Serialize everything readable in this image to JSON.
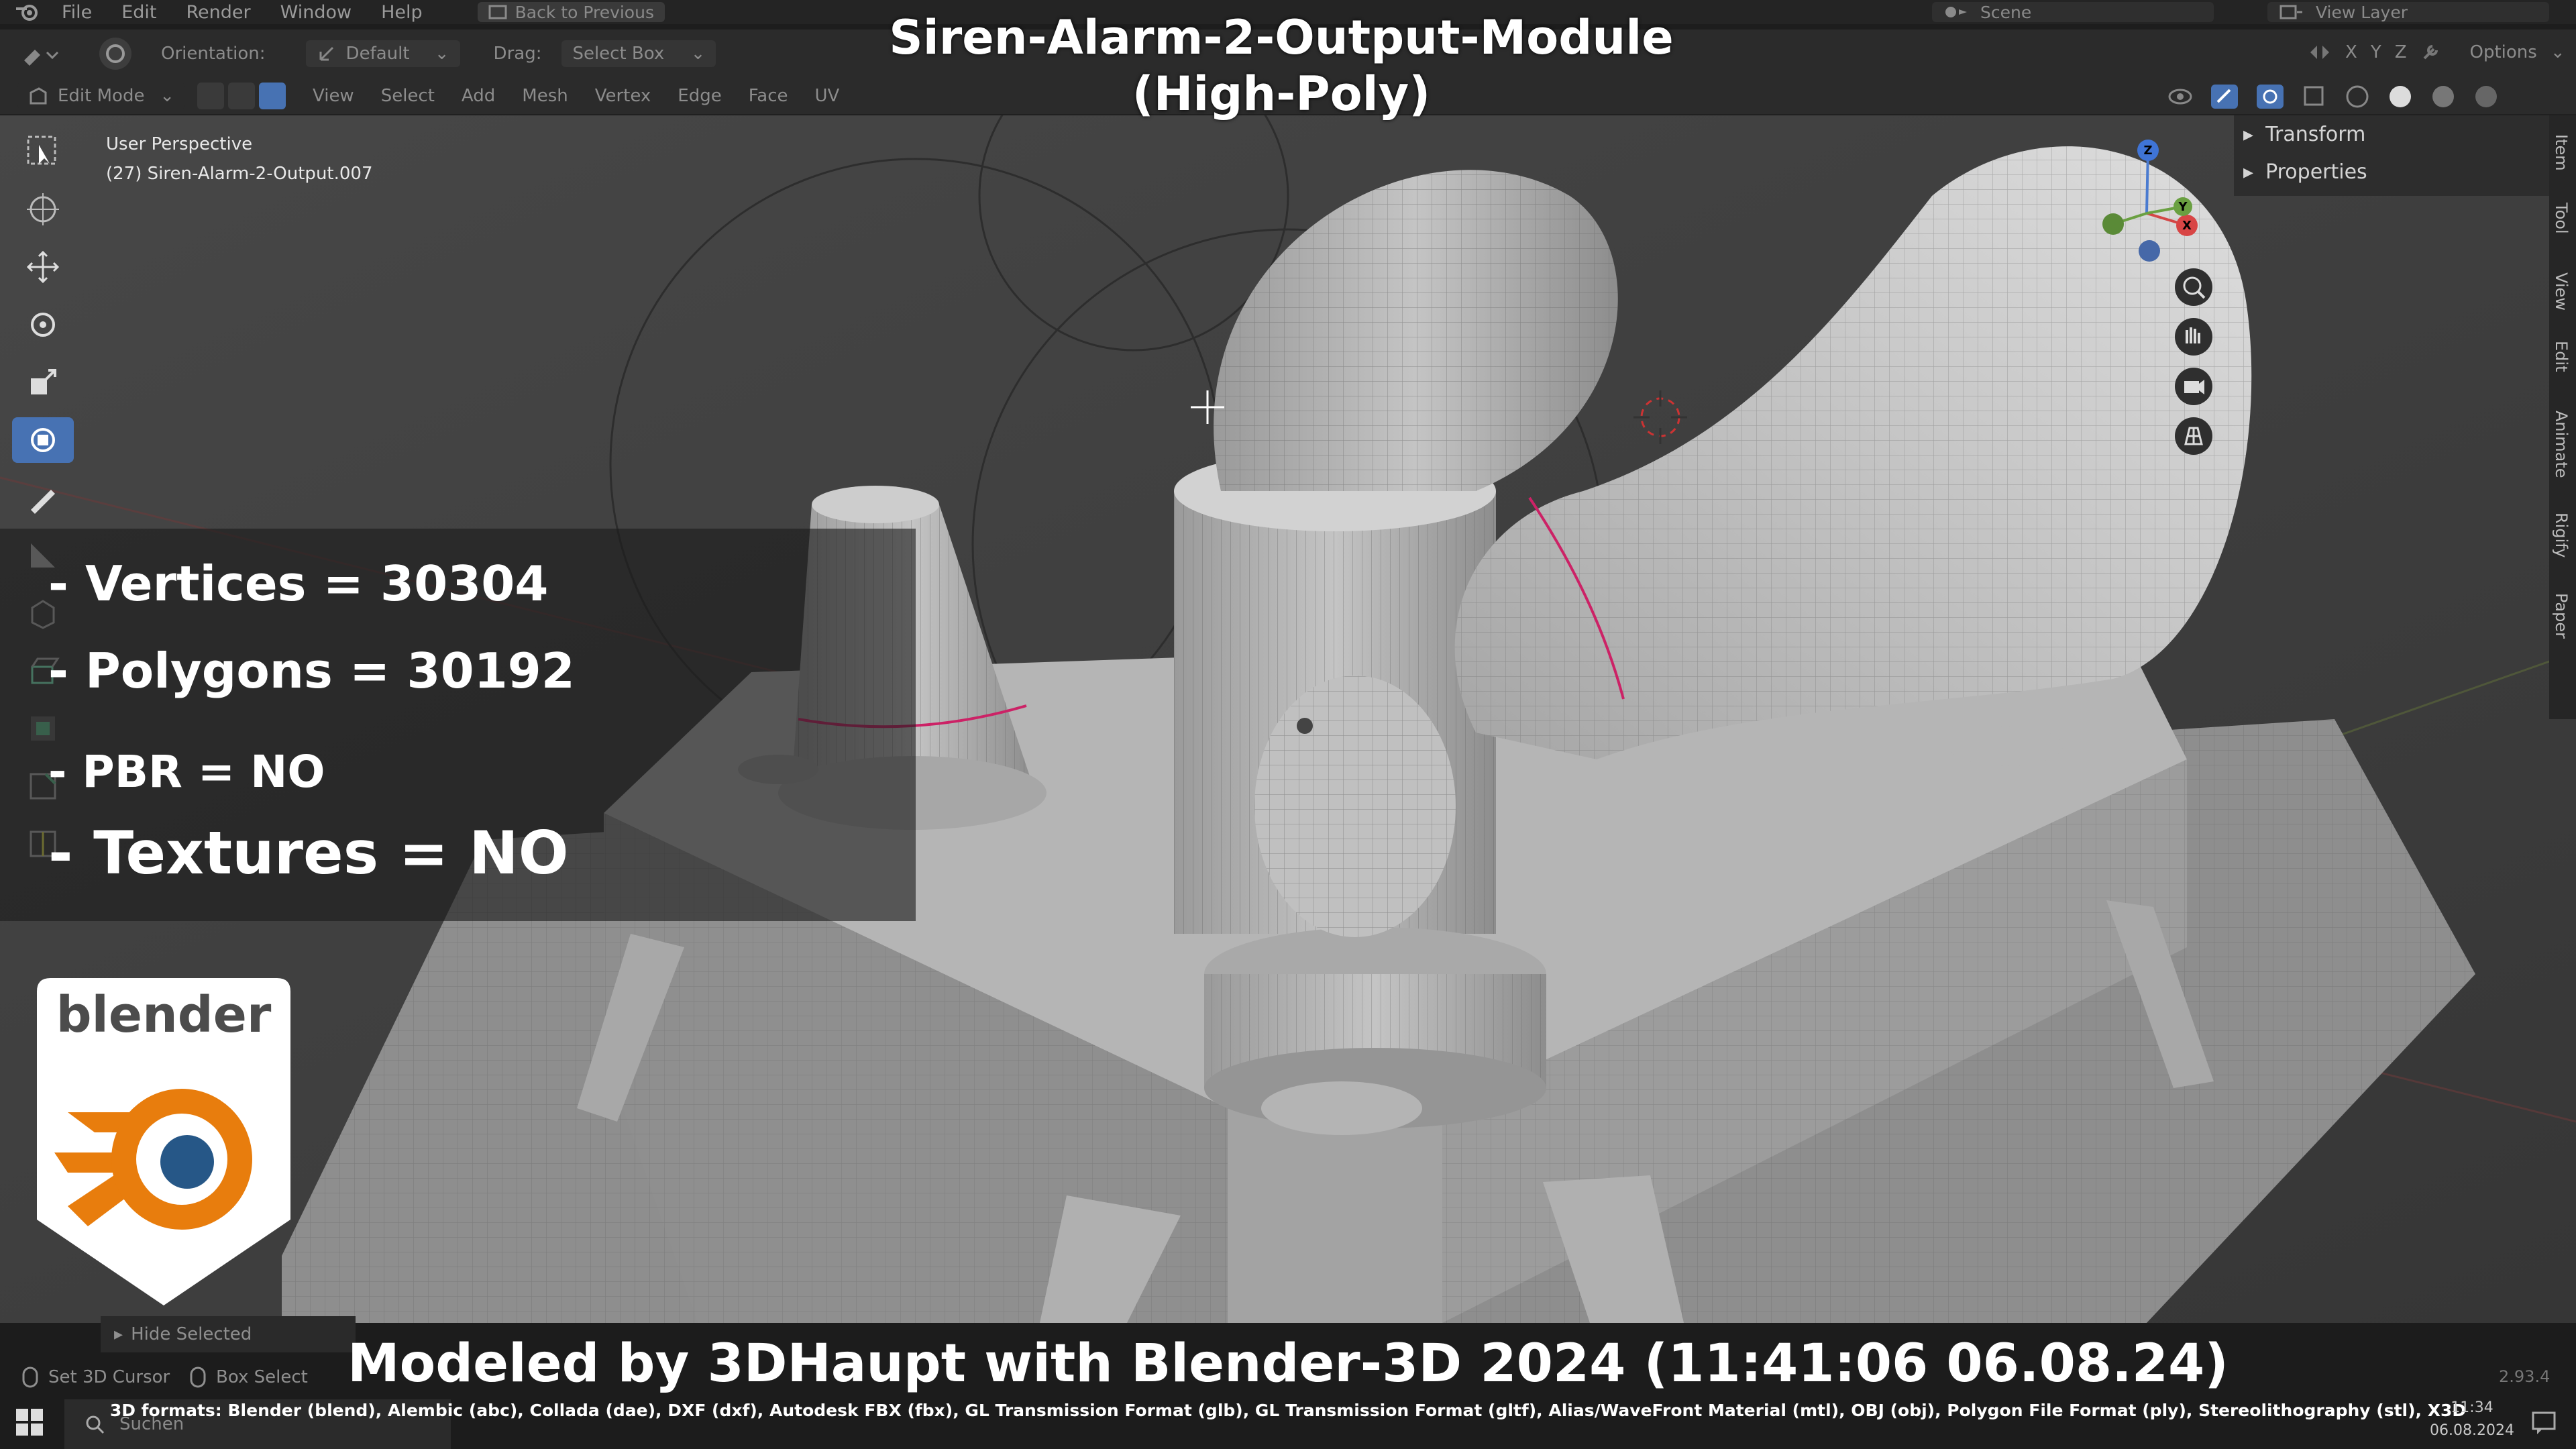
{
  "top_menu": {
    "items": [
      "File",
      "Edit",
      "Render",
      "Window",
      "Help"
    ],
    "back_button": "Back to Previous",
    "scene": "Scene",
    "view_layer": "View Layer"
  },
  "header": {
    "orientation_label": "Orientation:",
    "orientation_value": "Default",
    "drag_label": "Drag:",
    "drag_value": "Select Box",
    "options": "Options",
    "axes": [
      "X",
      "Y",
      "Z"
    ],
    "mode": "Edit Mode",
    "menus": [
      "View",
      "Select",
      "Add",
      "Mesh",
      "Vertex",
      "Edge",
      "Face",
      "UV"
    ]
  },
  "viewport": {
    "perspective": "User Perspective",
    "object": "(27) Siren-Alarm-2-Output.007",
    "gizmo_axes": {
      "x": "X",
      "y": "Y",
      "z": "Z"
    },
    "watermark": "3DHaupt"
  },
  "sidebar": {
    "panels": [
      "Transform",
      "Properties"
    ],
    "tabs": [
      "Item",
      "Tool",
      "View",
      "Edit",
      "Animate",
      "Rigify",
      "Paper"
    ]
  },
  "overlay": {
    "title_line1": "Siren-Alarm-2-Output-Module",
    "title_line2": "(High-Poly)",
    "vertices": "- Vertices = 30304",
    "polygons": "- Polygons = 30192",
    "pbr": "- PBR =  NO",
    "textures": "- Textures = NO",
    "logo_text": "blender",
    "credit": "Modeled by 3DHaupt with Blender-3D 2024 (11:41:06  06.08.24)",
    "formats": "3D formats: Blender (blend), Alembic (abc), Collada (dae), DXF (dxf), Autodesk FBX (fbx), GL Transmission Format (glb), GL Transmission Format (gltf), Alias/WaveFront Material (mtl), OBJ (obj), Polygon File Format (ply), Stereolithography (stl), X3D"
  },
  "status_bar": {
    "hide_selected": "Hide Selected",
    "set_cursor": "Set 3D Cursor",
    "box_select": "Box Select",
    "version": "2.93.4",
    "search": "Suchen",
    "clock_time": "11:34",
    "clock_date": "06.08.2024"
  },
  "colors": {
    "active_tool": "#4772b3",
    "blender_orange": "#e87d0d",
    "blender_blue": "#265787",
    "seam": "#cc2266"
  }
}
